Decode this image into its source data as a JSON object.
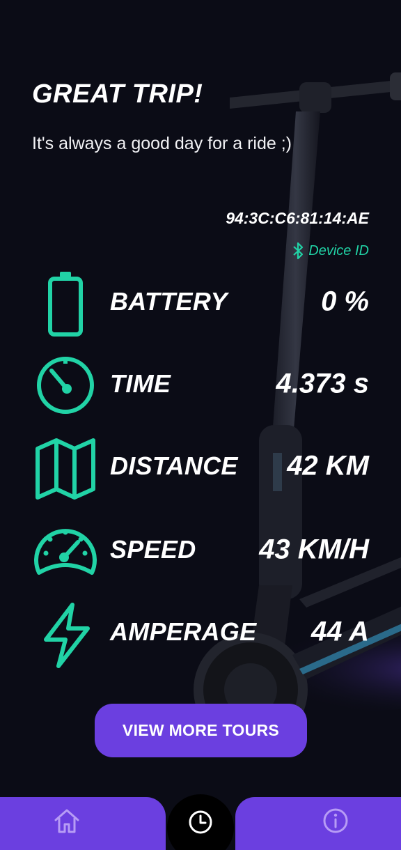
{
  "header": {
    "title": "GREAT TRIP!",
    "subtitle": "It's always a good day for a ride ;)"
  },
  "device": {
    "id_value": "94:3C:C6:81:14:AE",
    "id_label": "Device ID",
    "icon": "bluetooth-icon"
  },
  "stats": [
    {
      "icon": "battery-icon",
      "label": "BATTERY",
      "value": "0 %"
    },
    {
      "icon": "timer-icon",
      "label": "TIME",
      "value": "4.373 s"
    },
    {
      "icon": "map-icon",
      "label": "DISTANCE",
      "value": "42 KM"
    },
    {
      "icon": "speedometer-icon",
      "label": "SPEED",
      "value": "43 KM/H"
    },
    {
      "icon": "lightning-icon",
      "label": "AMPERAGE",
      "value": "44 A"
    }
  ],
  "actions": {
    "more_tours_label": "VIEW MORE TOURS"
  },
  "nav": {
    "items": [
      {
        "icon": "home-icon"
      },
      {
        "icon": "clock-icon",
        "active": true
      },
      {
        "icon": "info-icon"
      }
    ]
  },
  "colors": {
    "background": "#0b0c16",
    "accent": "#21d3a6",
    "primary": "#6b3fe0",
    "nav_icon_inactive": "#b79cf5"
  }
}
